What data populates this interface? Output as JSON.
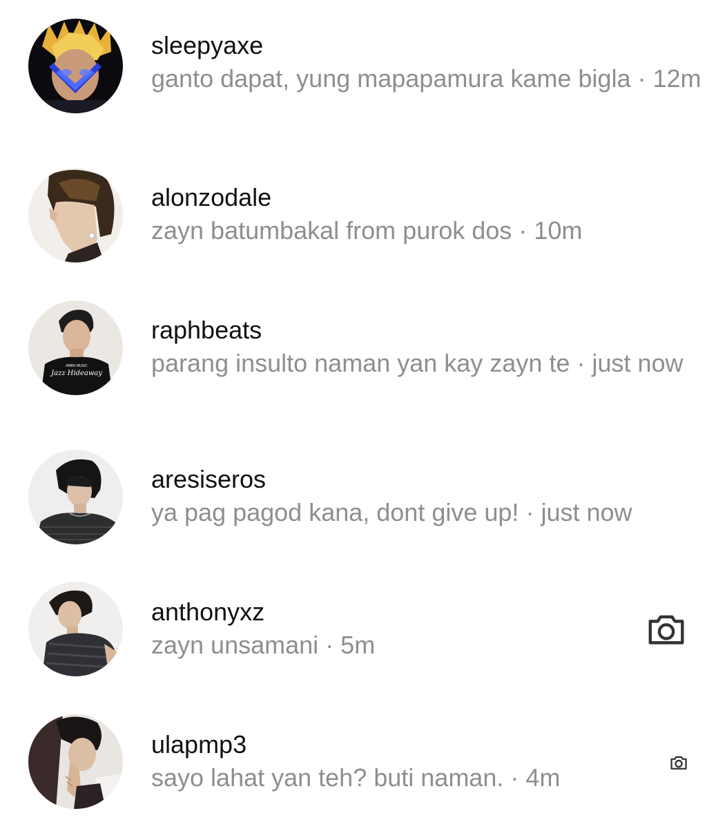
{
  "threads": [
    {
      "username": "sleepyaxe",
      "message": "ganto dapat, yung mapapamura kame bigla",
      "time": "12m",
      "avatar": "avatar-blonde-hair-hands-over-face",
      "has_camera": false
    },
    {
      "username": "alonzodale",
      "message": "zayn batumbakal from purok dos",
      "time": "10m",
      "avatar": "avatar-side-profile-earring",
      "has_camera": false
    },
    {
      "username": "raphbeats",
      "message": "parang insulto naman yan kay zayn te",
      "time": "just now",
      "avatar": "avatar-black-tshirt",
      "shirt_text": "Jazz Hideaway",
      "shirt_small_text": "AMIRI MUSIC",
      "has_camera": false
    },
    {
      "username": "aresiseros",
      "message": "ya pag pagod kana, dont give up!",
      "time": "just now",
      "avatar": "avatar-dark-knit-offshoulder",
      "has_camera": false
    },
    {
      "username": "anthonyxz",
      "message": "zayn unsamani",
      "time": "5m",
      "avatar": "avatar-sleeveless-knit",
      "has_camera": true,
      "camera_size": "large"
    },
    {
      "username": "ulapmp3",
      "message": "sayo lahat yan teh? buti naman.",
      "time": "4m",
      "avatar": "avatar-hand-on-face",
      "has_camera": true,
      "camera_size": "small"
    }
  ],
  "separator": "·",
  "colors": {
    "username": "#111111",
    "preview": "#8e8e8e",
    "camera_icon": "#333333",
    "background": "#ffffff"
  }
}
